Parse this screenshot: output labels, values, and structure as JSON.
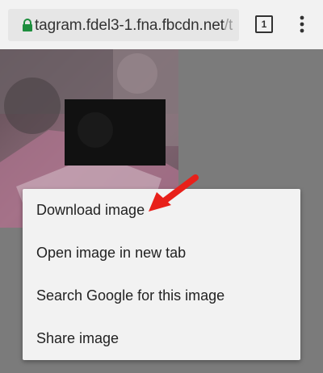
{
  "browser": {
    "url_prefix": "tagram.fdel3-1.fna.fbcdn.net",
    "url_suffix": "/t",
    "tab_count": "1",
    "icons": {
      "lock": "lock-icon",
      "menu": "more-vert-icon",
      "tabs": "tab-switcher-icon"
    },
    "secure_color": "#1e8e3e"
  },
  "context_menu": {
    "items": [
      {
        "label": "Download image"
      },
      {
        "label": "Open image in new tab"
      },
      {
        "label": "Search Google for this image"
      },
      {
        "label": "Share image"
      }
    ]
  },
  "annotation": {
    "color": "#e8201a"
  }
}
